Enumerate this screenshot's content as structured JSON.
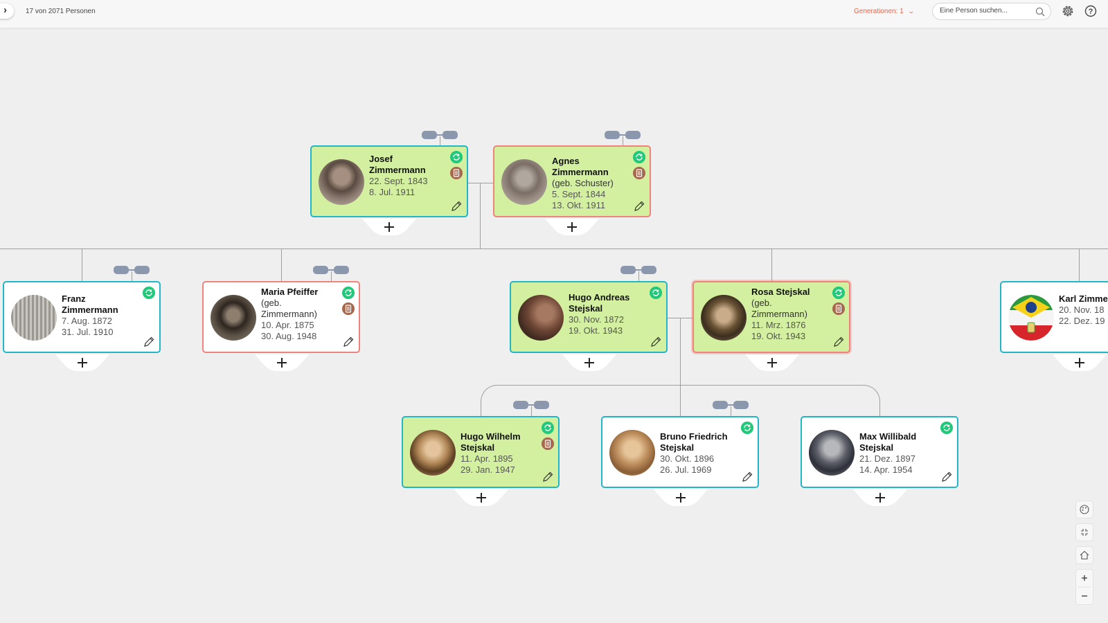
{
  "topbar": {
    "person_count": "17 von 2071 Personen",
    "generations_label": "Generationen:",
    "generations_value": "1",
    "search_placeholder": "Eine Person suchen...",
    "accent_color": "#e3654a"
  },
  "icons": [
    "chevron-right-icon",
    "chevron-down-icon",
    "search-icon",
    "gear-icon",
    "help-icon",
    "sync-icon",
    "document-icon",
    "pencil-icon",
    "plus-icon",
    "link-pair-icon",
    "palette-icon",
    "collapse-icon",
    "home-icon",
    "zoom-in-icon",
    "zoom-out-icon"
  ],
  "colors": {
    "male_border": "#22b5c6",
    "female_border": "#ee837b",
    "highlight_fill": "#d3f0a0",
    "sync_badge": "#22c97a",
    "document_badge": "#a8684e",
    "line": "#9e9e9e"
  },
  "persons": {
    "josef": {
      "name": "Josef Zimmermann",
      "birth": "22. Sept. 1843",
      "death": "8. Jul. 1911"
    },
    "agnes": {
      "name": "Agnes Zimmermann",
      "note": "(geb. Schuster)",
      "birth": "5. Sept. 1844",
      "death": "13. Okt. 1911"
    },
    "franz": {
      "name": "Franz Zimmermann",
      "birth": "7. Aug. 1872",
      "death": "31. Jul. 1910"
    },
    "maria": {
      "name": "Maria Pfeiffer",
      "note": "(geb. Zimmermann)",
      "birth": "10. Apr. 1875",
      "death": "30. Aug. 1948"
    },
    "hugo_andreas": {
      "name": "Hugo Andreas Stejskal",
      "birth": "30. Nov. 1872",
      "death": "19. Okt. 1943"
    },
    "rosa": {
      "name": "Rosa Stejskal",
      "note": "(geb. Zimmermann)",
      "birth": "11. Mrz. 1876",
      "death": "19. Okt. 1943"
    },
    "karl": {
      "name": "Karl Zimmerman",
      "birth": "20. Nov. 18",
      "death": "22. Dez. 19"
    },
    "hugo_wilhelm": {
      "name": "Hugo Wilhelm Stejskal",
      "birth": "11. Apr. 1895",
      "death": "29. Jan. 1947"
    },
    "bruno": {
      "name": "Bruno Friedrich Stejskal",
      "birth": "30. Okt. 1896",
      "death": "26. Jul. 1969"
    },
    "max": {
      "name": "Max Willibald Stejskal",
      "birth": "21. Dez. 1897",
      "death": "14. Apr. 1954"
    }
  }
}
